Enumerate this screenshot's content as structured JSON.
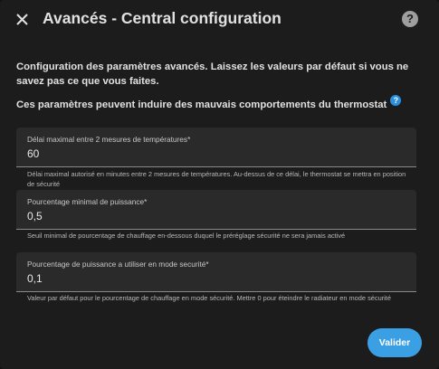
{
  "dialog": {
    "title": "Avancés - Central configuration",
    "help_symbol": "?"
  },
  "intro_text": "Configuration des paramètres avancés. Laissez les valeurs par défaut si vous ne savez pas ce que vous faites.",
  "warning_text": "Ces paramètres peuvent induire des mauvais comportements du thermostat",
  "info_symbol": "?",
  "fields": [
    {
      "label": "Délai maximal entre 2 mesures de températures*",
      "value": "60",
      "helper": "Délai maximal autorisé en minutes entre 2 mesures de températures. Au-dessus de ce délai, le thermostat se mettra en position de sécurité"
    },
    {
      "label": "Pourcentage minimal de puissance*",
      "value": "0,5",
      "helper": "Seuil minimal de pourcentage de chauffage en-dessous duquel le préréglage sécurité ne sera jamais activé"
    },
    {
      "label": "Pourcentage de puissance a utiliser en mode securité*",
      "value": "0,1",
      "helper": "Valeur par défaut pour le pourcentage de chauffage en mode sécurité. Mettre 0 pour éteindre le radiateur en mode sécurité"
    }
  ],
  "submit_label": "Valider",
  "colors": {
    "background": "#1c1c1c",
    "field_bg": "#2a2a2a",
    "accent": "#3b9fe4",
    "info": "#2b8fe0"
  },
  "icons": {
    "close": "close-icon",
    "help": "help-circle-icon",
    "info": "info-icon"
  }
}
